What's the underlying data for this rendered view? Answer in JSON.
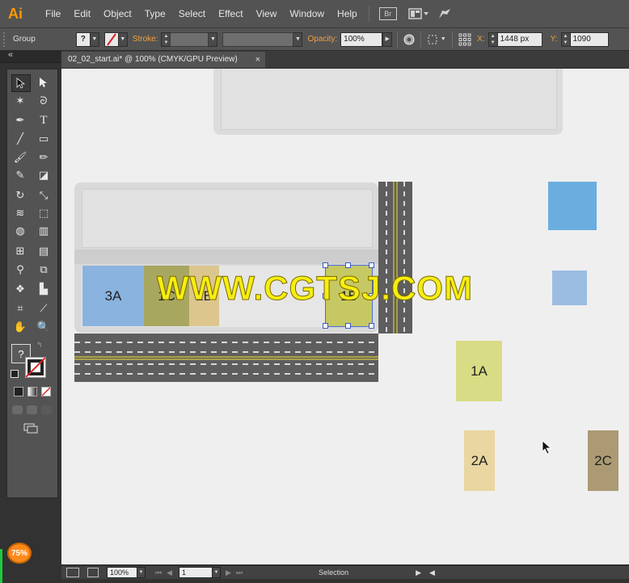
{
  "app": {
    "logo_text": "Ai"
  },
  "menu": {
    "items": [
      "File",
      "Edit",
      "Object",
      "Type",
      "Select",
      "Effect",
      "View",
      "Window",
      "Help"
    ],
    "bridge_label": "Br"
  },
  "control_bar": {
    "selection_type": "Group",
    "stroke_label": "Stroke:",
    "opacity_label": "Opacity:",
    "opacity_value": "100%",
    "x_label": "X:",
    "x_value": "1448 px",
    "y_label": "Y:",
    "y_value": "1090"
  },
  "document_tab": {
    "title": "02_02_start.ai* @ 100% (CMYK/GPU Preview)",
    "close_glyph": "×"
  },
  "toolbar": {
    "collapse_glyph": "«",
    "fill_stroke_question": "?"
  },
  "canvas": {
    "watermark": "WWW.CGTSJ.COM",
    "blocks": [
      {
        "label": "3A",
        "color": "#8ab3df"
      },
      {
        "label": "1C",
        "color": "#a8a760"
      },
      {
        "label": "2B",
        "color": "#dcc68e"
      },
      {
        "label": "1B",
        "color": "#c6c864"
      },
      {
        "label": "1A",
        "color": "#d8dc84"
      },
      {
        "label": "2A",
        "color": "#e9d6a1"
      },
      {
        "label": "2C",
        "color": "#ab9a74"
      }
    ],
    "swatch_colors": [
      "#6aaee0",
      "#9cbde2"
    ]
  },
  "status_bar": {
    "zoom_value": "100%",
    "page_value": "1",
    "tool_name": "Selection"
  },
  "overlay": {
    "zoom_badge": "75%"
  }
}
